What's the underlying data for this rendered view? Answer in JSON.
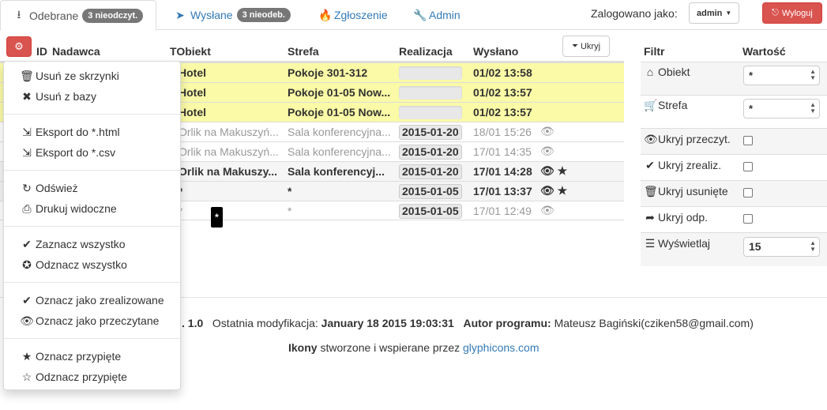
{
  "nav": {
    "tabs": [
      {
        "label": "Odebrane",
        "badge": "3 nieodczyt.",
        "icon": "download-icon"
      },
      {
        "label": "Wysłane",
        "badge": "3 nieodeb.",
        "icon": "send-icon"
      },
      {
        "label": "Zgłoszenie",
        "icon": "fire-icon"
      },
      {
        "label": "Admin",
        "icon": "wrench-icon"
      }
    ],
    "login_label": "Zalogowano jako:",
    "user": "admin",
    "logout": "Wyloguj"
  },
  "table": {
    "headers": {
      "id": "ID",
      "sender": "Nadawca",
      "object": "Obiekt",
      "zone": "Strefa",
      "realization": "Realizacja",
      "sent": "Wysłano",
      "hide": "Ukryj"
    },
    "rows": [
      {
        "object": "Hotel",
        "zone": "Pokoje 301-312",
        "realization": "",
        "sent": "01/02 13:58",
        "style": "unread"
      },
      {
        "object": "Hotel",
        "zone": "Pokoje 01-05 Now...",
        "realization": "",
        "sent": "01/02 13:57",
        "style": "unread"
      },
      {
        "object": "Hotel",
        "zone": "Pokoje 01-05 Now...",
        "realization": "",
        "sent": "01/02 13:57",
        "style": "unread"
      },
      {
        "object": "Orlik na Makuszyń...",
        "zone": "Sala konferencyjna...",
        "realization": "2015-01-20",
        "sent": "18/01 15:26",
        "style": "read",
        "icons": "👁"
      },
      {
        "object": "Orlik na Makuszyń...",
        "zone": "Sala konferencyjna...",
        "realization": "2015-01-20",
        "sent": "17/01 14:35",
        "style": "read",
        "icons": "👁"
      },
      {
        "object": "Orlik na Makuszy...",
        "zone": "Sala konferencyj...",
        "realization": "2015-01-20",
        "sent": "17/01 14:28",
        "style": "bold",
        "icons": "👁 ★"
      },
      {
        "object": "*",
        "zone": "*",
        "realization": "2015-01-05",
        "sent": "17/01 13:37",
        "style": "bold",
        "icons": "👁 ★"
      },
      {
        "object": "*",
        "zone": "*",
        "realization": "2015-01-05",
        "sent": "17/01 12:49",
        "style": "read",
        "icons": "👁"
      }
    ],
    "tooltip": "*"
  },
  "menu": {
    "items": [
      {
        "label": "Usuń ze skrzynki",
        "icon": "trash-icon"
      },
      {
        "label": "Usuń z bazy",
        "icon": "remove-icon"
      },
      {
        "label": "Eksport do *.html",
        "icon": "export-icon"
      },
      {
        "label": "Eksport do *.csv",
        "icon": "export-icon"
      },
      {
        "label": "Odśwież",
        "icon": "refresh-icon"
      },
      {
        "label": "Drukuj widoczne",
        "icon": "print-icon"
      },
      {
        "label": "Zaznacz wszystko",
        "icon": "check-circle-icon"
      },
      {
        "label": "Odznacz wszystko",
        "icon": "remove-circle-icon"
      },
      {
        "label": "Oznacz jako zrealizowane",
        "icon": "ok-icon"
      },
      {
        "label": "Oznacz jako przeczytane",
        "icon": "eye-icon"
      },
      {
        "label": "Oznacz przypięte",
        "icon": "star-icon"
      },
      {
        "label": "Odznacz przypięte",
        "icon": "star-empty-icon"
      }
    ]
  },
  "filter": {
    "header_filter": "Filtr",
    "header_value": "Wartość",
    "object_label": "Obiekt",
    "object_value": "*",
    "zone_label": "Strefa",
    "zone_value": "*",
    "hide_read": "Ukryj przeczyt.",
    "hide_done": "Ukryj zrealiz.",
    "hide_deleted": "Ukryj usunięte",
    "hide_replied": "Ukryj odp.",
    "display_label": "Wyświetlaj",
    "display_value": "15"
  },
  "footer": {
    "version_tail": ". 1.0",
    "modified_label": "Ostatnia modyfikacja:",
    "modified_value": "January 18 2015 19:03:31",
    "author_label": "Autor programu:",
    "author_value": "Mateusz Bagiński(cziken58@gmail.com)",
    "icons_label": "Ikony",
    "icons_text": "stworzone i wspierane przez",
    "icons_link": "glyphicons.com"
  }
}
